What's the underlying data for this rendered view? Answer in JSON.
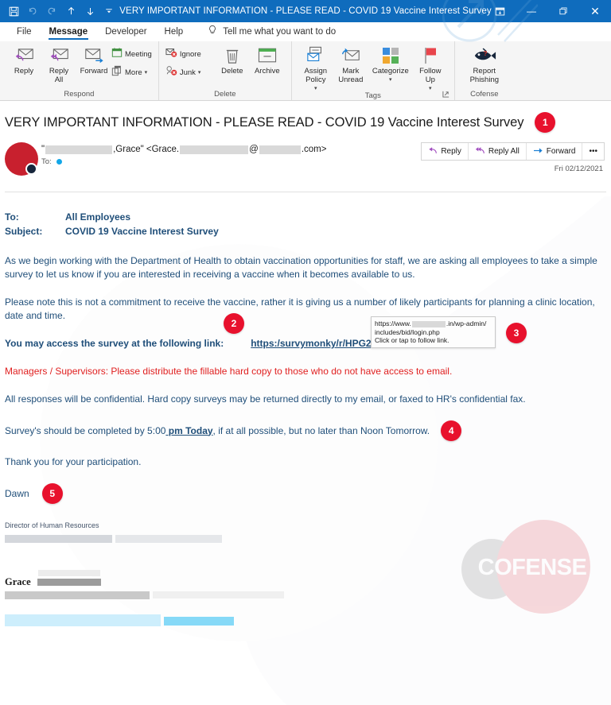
{
  "window": {
    "title": "VERY IMPORTANT INFORMATION - PLEASE READ - COVID 19 Vaccine Interest Survey",
    "quick_access": [
      {
        "name": "save-icon",
        "glyph": "💾"
      },
      {
        "name": "undo-icon",
        "glyph": "↶"
      },
      {
        "name": "redo-icon",
        "glyph": "↷"
      },
      {
        "name": "previous-item-icon",
        "glyph": "↑"
      },
      {
        "name": "next-item-icon",
        "glyph": "↓"
      },
      {
        "name": "customize-quick-access-icon",
        "glyph": "▾"
      }
    ],
    "controls": {
      "ribbon_display": "⊞",
      "minimize": "—",
      "restore": "❐",
      "close": "✕"
    }
  },
  "tabs": [
    {
      "label": "File",
      "active": false
    },
    {
      "label": "Message",
      "active": true
    },
    {
      "label": "Developer",
      "active": false
    },
    {
      "label": "Help",
      "active": false
    }
  ],
  "tell_me": {
    "icon": "lightbulb-icon",
    "label": "Tell me what you want to do"
  },
  "ribbon": {
    "groups": [
      {
        "label": "Respond",
        "big_buttons": [
          {
            "name": "reply-button",
            "label": "Reply"
          },
          {
            "name": "reply-all-button",
            "label": "Reply\nAll"
          },
          {
            "name": "forward-button",
            "label": "Forward"
          }
        ],
        "small_buttons": [
          {
            "name": "meeting-button",
            "label": "Meeting",
            "caret": false
          },
          {
            "name": "more-respond-button",
            "label": "More",
            "caret": true
          }
        ]
      },
      {
        "label": "Delete",
        "small_buttons": [
          {
            "name": "ignore-button",
            "label": "Ignore",
            "caret": false
          },
          {
            "name": "junk-button",
            "label": "Junk",
            "caret": true
          }
        ],
        "big_buttons": [
          {
            "name": "delete-button",
            "label": "Delete"
          },
          {
            "name": "archive-button",
            "label": "Archive"
          }
        ]
      },
      {
        "label": "Tags",
        "has_dialog_launcher": true,
        "big_buttons": [
          {
            "name": "assign-policy-button",
            "label": "Assign\nPolicy",
            "caret": true
          },
          {
            "name": "mark-unread-button",
            "label": "Mark\nUnread",
            "caret": false
          },
          {
            "name": "categorize-button",
            "label": "Categorize",
            "caret": true
          },
          {
            "name": "follow-up-button",
            "label": "Follow\nUp",
            "caret": true
          }
        ]
      },
      {
        "label": "Cofense",
        "big_buttons": [
          {
            "name": "report-phishing-button",
            "label": "Report\nPhishing"
          }
        ]
      }
    ]
  },
  "email": {
    "subject": "VERY IMPORTANT INFORMATION - PLEASE READ - COVID 19 Vaccine Interest Survey",
    "sender": {
      "display_prefix": "\"",
      "display_name_visible": ",Grace\"",
      "address_visible_start": "<Grace.",
      "address_at": "@",
      "address_tld": ".com>"
    },
    "to_label": "To:",
    "date": "Fri 02/12/2021",
    "actions": [
      {
        "name": "reply-action-button",
        "label": "Reply",
        "icon": "reply-arrow-icon"
      },
      {
        "name": "reply-all-action-button",
        "label": "Reply All",
        "icon": "reply-all-arrow-icon"
      },
      {
        "name": "forward-action-button",
        "label": "Forward",
        "icon": "forward-arrow-icon"
      },
      {
        "name": "more-actions-button",
        "label": "•••",
        "icon": "ellipsis-icon"
      }
    ],
    "headers": [
      {
        "key": "To:",
        "value": "All Employees"
      },
      {
        "key": "Subject:",
        "value": "COVID 19 Vaccine Interest Survey"
      }
    ],
    "paragraphs": [
      "As we begin working with the Department of Health to obtain vaccination opportunities for staff, we are asking all employees to take a simple survey to let us know if you are interested in receiving a vaccine when it becomes available to us.",
      "Please note this is not a commitment to receive the vaccine, rather it is giving us a number of likely participants for planning a clinic location, date and time."
    ],
    "link_label": "You may access the survey at the following link:",
    "link_text": "https:/survymonky/r/HPG2",
    "tooltip": {
      "url_line1_prefix": "https://www.",
      "url_line1_suffix": ".in/wp-admin/",
      "url_line2": "includes/bid/login.php",
      "hint": "Click or tap to follow link."
    },
    "red_notice": "Managers / Supervisors:  Please distribute the fillable hard copy to those who do not have access to email.",
    "confidential_note": "All responses will be confidential.  Hard copy surveys may be returned directly to my email, or faxed to HR's confidential fax.",
    "deadline": {
      "before": "Survey's should be completed by 5:00",
      "emphasis": " pm Today",
      "after": ", if at all possible,  but no later than Noon Tomorrow."
    },
    "thanks": "Thank you for your participation.",
    "sign_off": "Dawn",
    "signature": {
      "title": "Director of Human Resources",
      "name": "Grace"
    }
  },
  "annotations": [
    {
      "id": "1",
      "target": "subject-line"
    },
    {
      "id": "2",
      "target": "display-link"
    },
    {
      "id": "3",
      "target": "link-tooltip"
    },
    {
      "id": "4",
      "target": "deadline-line"
    },
    {
      "id": "5",
      "target": "sign-off"
    }
  ],
  "watermark": {
    "text": "COFENSE",
    "gray": "#a6a6a6",
    "pink": "#e8838f"
  },
  "colors": {
    "titlebar": "#0f6cbd",
    "body_text": "#1f4e79",
    "warning": "#e02020",
    "badge": "#e8112d",
    "avatar": "#c8202e"
  }
}
